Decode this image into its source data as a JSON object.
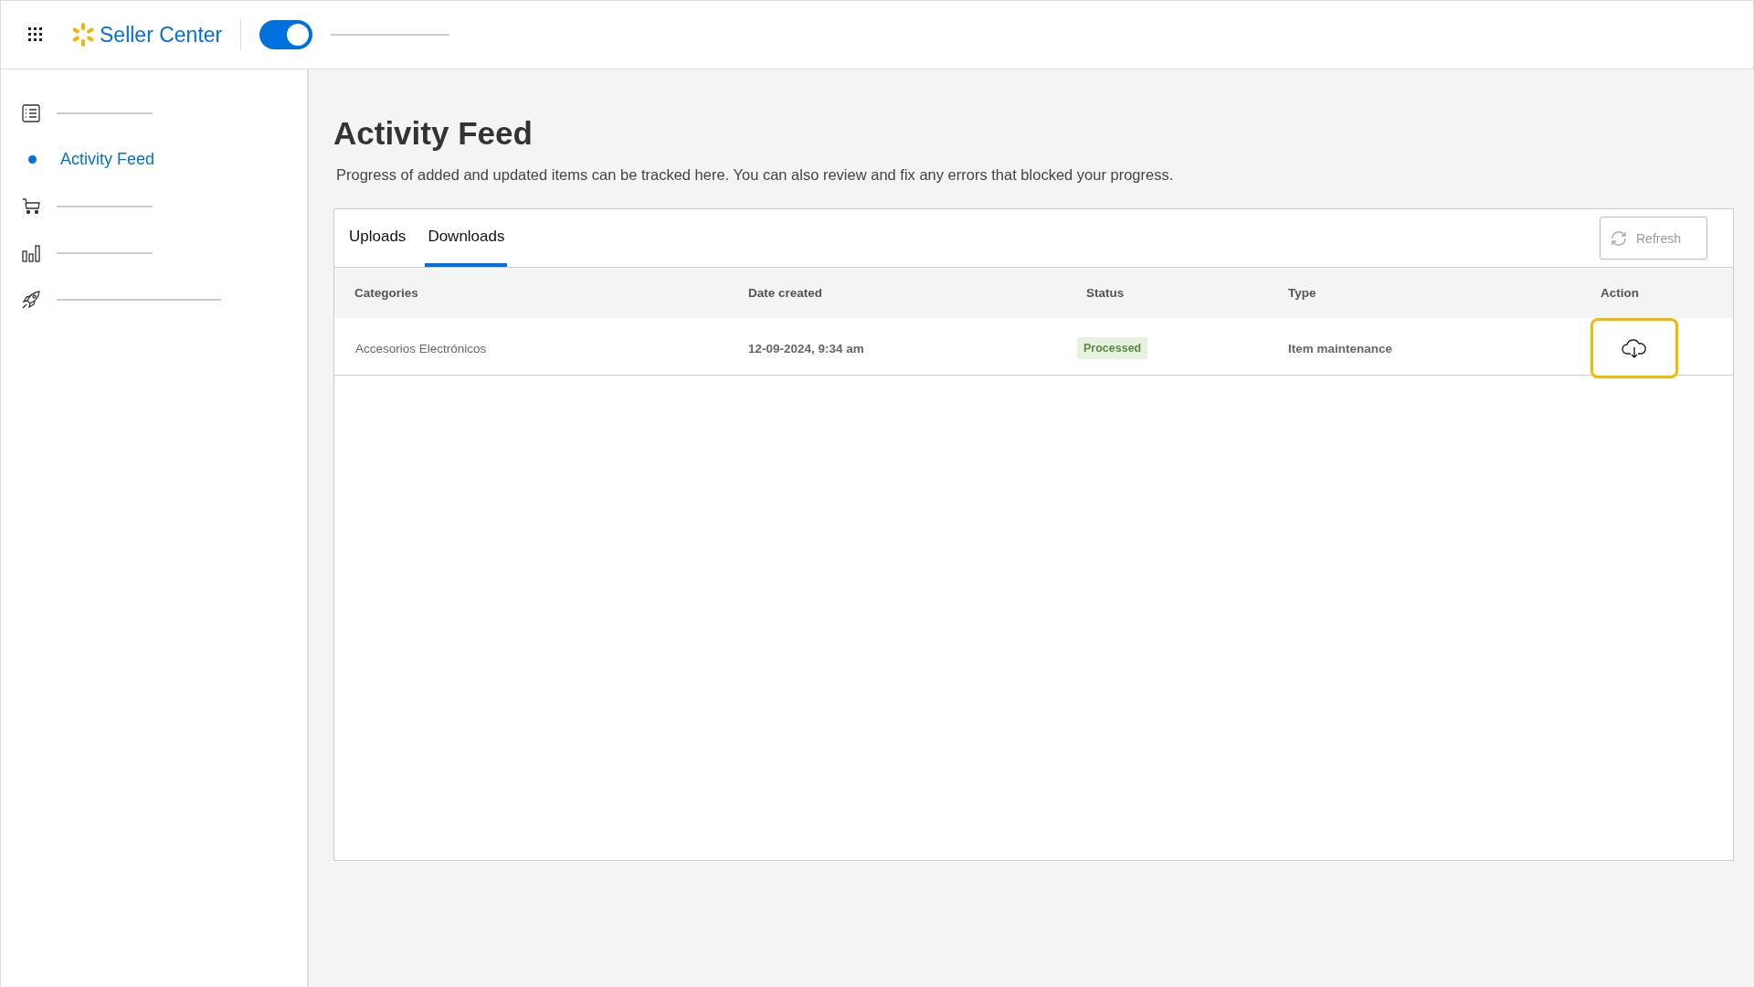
{
  "header": {
    "brand": "Seller Center",
    "toggle": {
      "on": true
    }
  },
  "sidebar": {
    "items": [
      {
        "kind": "list",
        "selected": false
      },
      {
        "kind": "label",
        "label": "Activity Feed",
        "selected": true
      },
      {
        "kind": "cart",
        "selected": false
      },
      {
        "kind": "chart",
        "selected": false
      },
      {
        "kind": "rocket",
        "selected": false
      }
    ]
  },
  "page": {
    "title": "Activity Feed",
    "description": "Progress of added and updated items can be tracked here. You can also review and fix any errors that blocked your progress."
  },
  "tabs": [
    {
      "label": "Uploads",
      "selected": false
    },
    {
      "label": "Downloads",
      "selected": true
    }
  ],
  "refresh_button": {
    "label": "Refresh",
    "disabled": true
  },
  "table": {
    "columns": [
      "Categories",
      "Date created",
      "Status",
      "Type",
      "Action"
    ],
    "rows": [
      {
        "category": "Accesorios Electrónicos",
        "date": "12-09-2024, 9:34 am",
        "status": "Processed",
        "type": "Item maintenance",
        "action_highlighted": true
      }
    ]
  }
}
